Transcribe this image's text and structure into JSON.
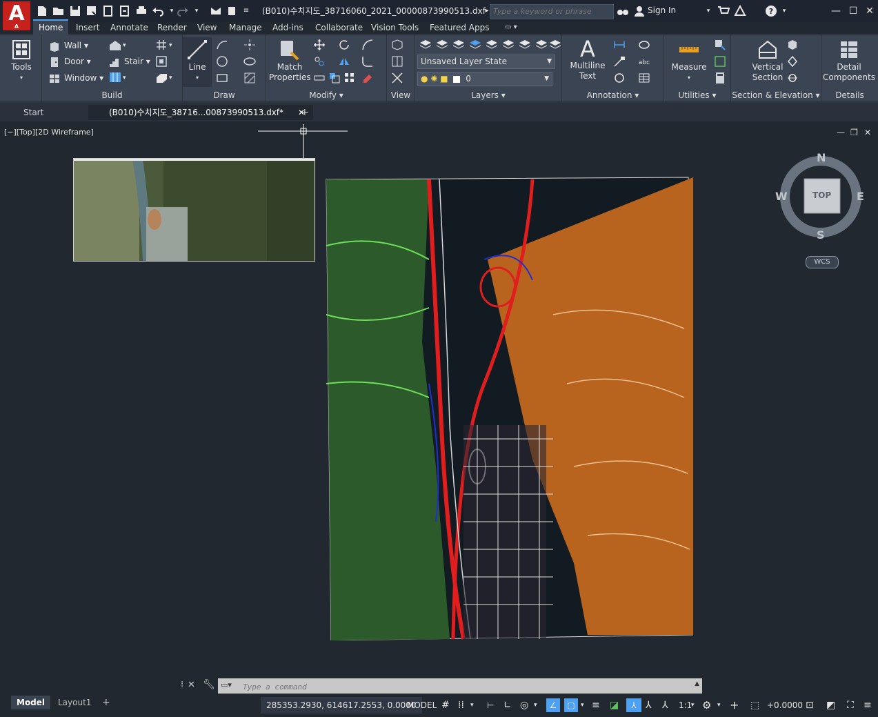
{
  "app": {
    "logo_letter": "A",
    "logo_sub": "A"
  },
  "titlebar": {
    "document_title": "(B010)수치지도_38716060_2021_00000873990513.dxf",
    "search_placeholder": "Type a keyword or phrase",
    "sign_in": "Sign In"
  },
  "ribbon_tabs": [
    "Home",
    "Insert",
    "Annotate",
    "Render",
    "View",
    "Manage",
    "Add-ins",
    "Collaborate",
    "Vision Tools",
    "Featured Apps"
  ],
  "ribbon": {
    "tools": {
      "label": "Tools"
    },
    "build": {
      "title": "Build",
      "wall": "Wall",
      "door": "Door",
      "window": "Window",
      "stair": "Stair"
    },
    "draw": {
      "title": "Draw",
      "line": "Line"
    },
    "modify": {
      "title": "Modify",
      "match_properties": "Match\nProperties"
    },
    "view": {
      "title": "View"
    },
    "layers": {
      "title": "Layers",
      "layer_state": "Unsaved Layer State",
      "current_layer": "0"
    },
    "annotation": {
      "title": "Annotation",
      "multiline_text": "Multiline\nText"
    },
    "utilities": {
      "title": "Utilities",
      "measure": "Measure"
    },
    "section_elevation": {
      "title": "Section & Elevation",
      "vertical_section": "Vertical\nSection"
    },
    "details": {
      "title": "Details",
      "detail_components": "Detail\nComponents"
    }
  },
  "file_tabs": {
    "start": "Start",
    "active": "(B010)수치지도_38716...00873990513.dxf*"
  },
  "viewport": {
    "label": "[−][Top][2D Wireframe]"
  },
  "viewcube": {
    "n": "N",
    "s": "S",
    "e": "E",
    "w": "W",
    "top": "TOP",
    "wcs": "WCS"
  },
  "command": {
    "placeholder": "Type a command"
  },
  "layout_tabs": [
    "Model",
    "Layout1"
  ],
  "status": {
    "coordinates": "285353.2930, 614617.2553, 0.0000",
    "model": "MODEL",
    "scale": "1:1",
    "annotation_value": "+0.0000"
  },
  "colors": {
    "accent": "#4ea0f0",
    "logo": "#c6211d",
    "background": "#212830",
    "ribbon": "#3b4453"
  }
}
